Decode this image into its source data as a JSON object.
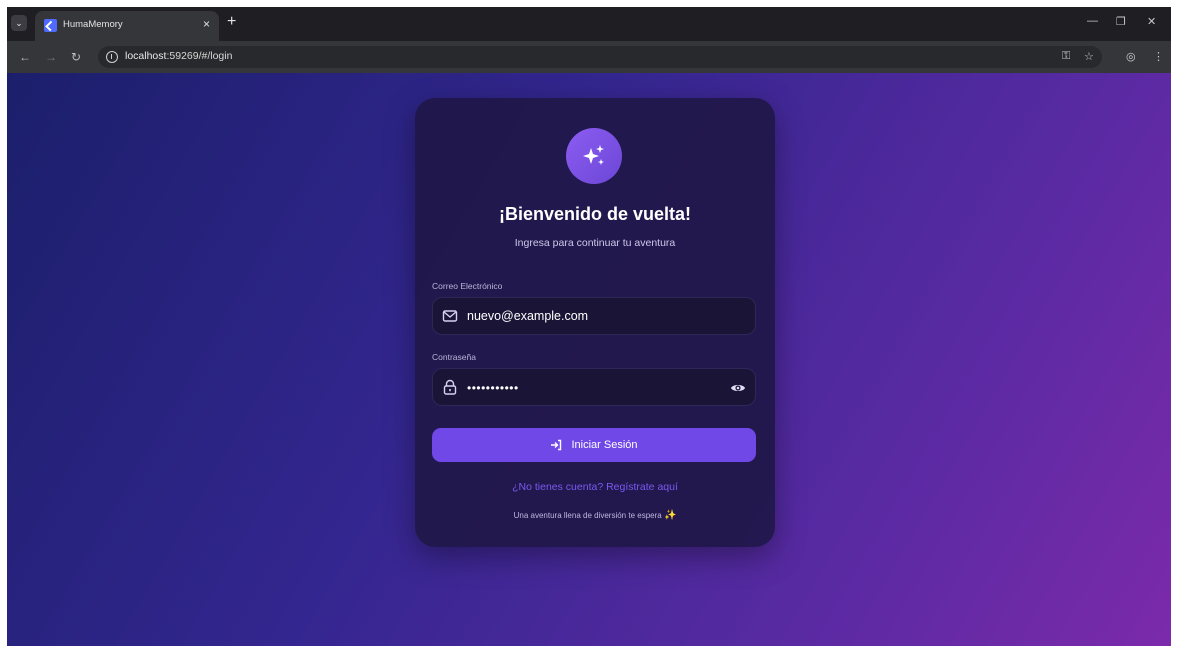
{
  "browser": {
    "tab_title": "HumaMemory",
    "url_host": "localhost",
    "url_rest": ":59269/#/login",
    "new_tab_glyph": "+",
    "tab_close_glyph": "×",
    "minimize_glyph": "—",
    "restore_glyph": "❐",
    "close_glyph": "✕"
  },
  "login": {
    "title": "¡Bienvenido de vuelta!",
    "subtitle": "Ingresa para continuar tu aventura",
    "email_label": "Correo Electrónico",
    "email_value": "nuevo@example.com",
    "password_label": "Contraseña",
    "password_mask": "•••••••••••",
    "submit_label": "Iniciar Sesión",
    "register_link": "¿No tienes cuenta? Regístrate aquí",
    "footer_text": "Una aventura llena de diversión te espera",
    "footer_emoji": "✨"
  },
  "colors": {
    "accent": "#7048e8",
    "link": "#7a59f0",
    "card_bg": "#1f1748"
  }
}
